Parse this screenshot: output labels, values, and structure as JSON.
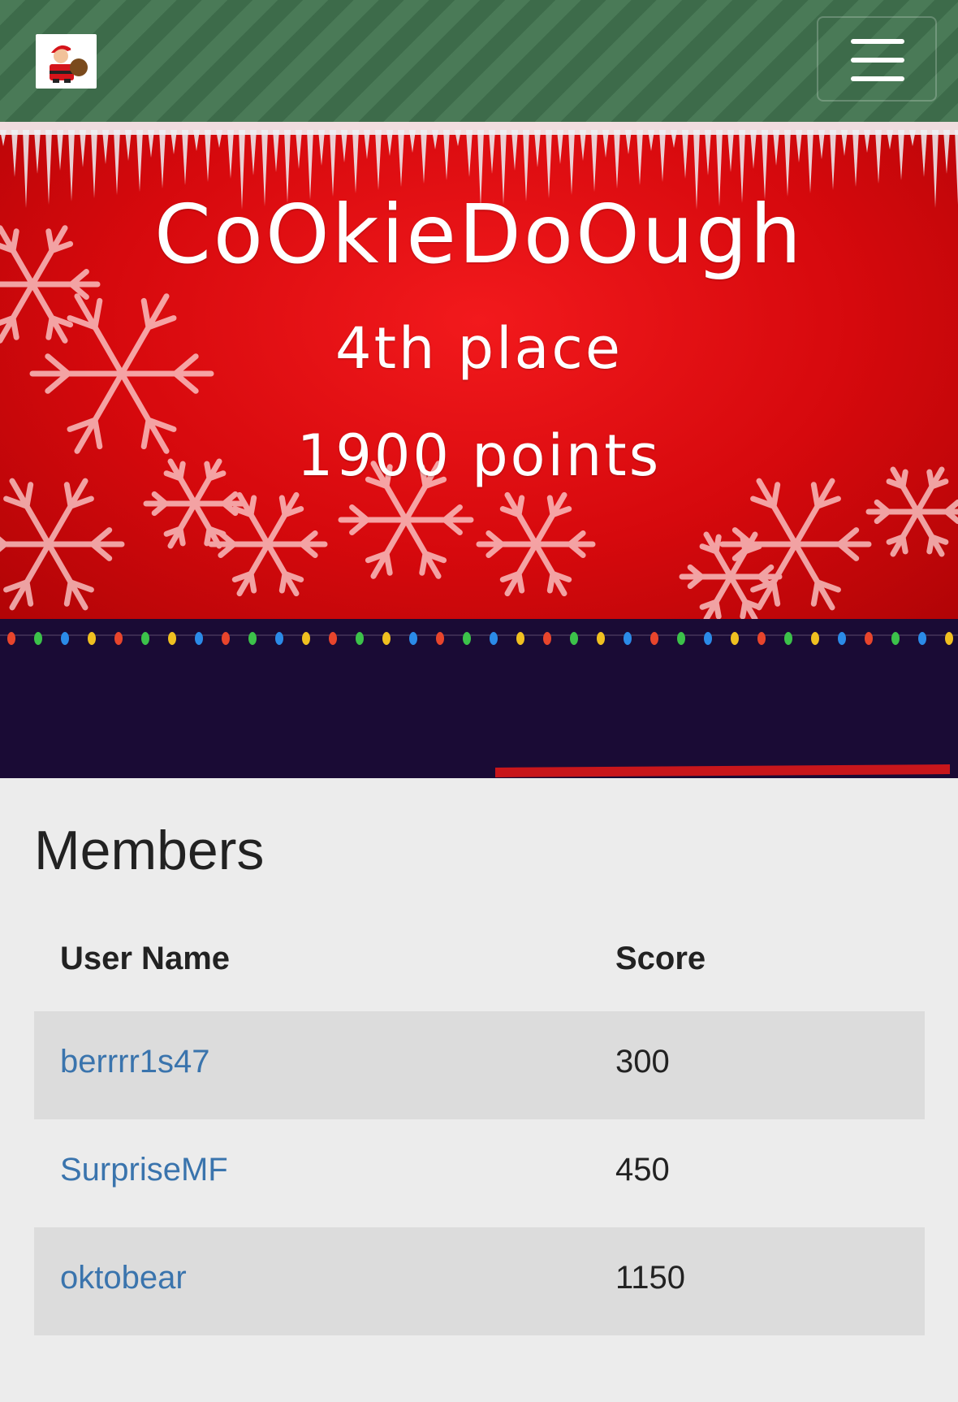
{
  "navbar": {
    "logo_icon": "santa-icon",
    "menu_icon": "hamburger-menu-icon"
  },
  "banner": {
    "team_name": "CoOkieDoOugh",
    "place": "4th place",
    "points": "1900 points",
    "background_color": "#d6090d"
  },
  "members": {
    "title": "Members",
    "columns": [
      "User Name",
      "Score"
    ],
    "rows": [
      {
        "user": "berrrr1s47",
        "score": "300"
      },
      {
        "user": "SurpriseMF",
        "score": "450"
      },
      {
        "user": "oktobear",
        "score": "1150"
      }
    ]
  },
  "colors": {
    "navbar_green": "#4a7a57",
    "lights_band": "#1a0b35",
    "link_blue": "#3a74ad"
  }
}
